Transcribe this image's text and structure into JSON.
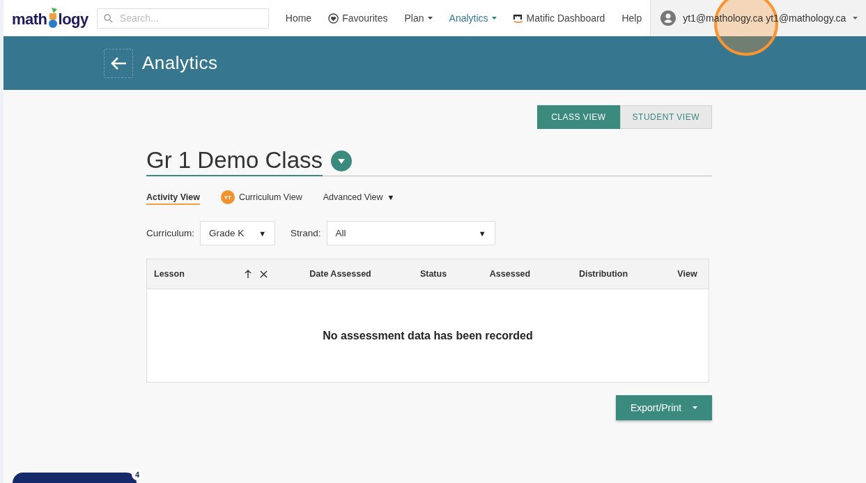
{
  "navbar": {
    "logo": {
      "before": "math",
      "after": "logy"
    },
    "search": {
      "placeholder": "Search..."
    },
    "items": [
      {
        "kind": "link",
        "label": "Home",
        "selected": false
      },
      {
        "kind": "favourites",
        "label": "Favourites",
        "selected": false
      },
      {
        "kind": "menu",
        "label": "Plan",
        "selected": false
      },
      {
        "kind": "menu",
        "label": "Analytics",
        "selected": true
      },
      {
        "kind": "brand",
        "label": "Matific Dashboard",
        "selected": false
      },
      {
        "kind": "link",
        "label": "Help",
        "selected": false
      }
    ],
    "user": {
      "email": "yt1@mathology.ca yt1@mathology.ca"
    }
  },
  "header": {
    "title": "Analytics"
  },
  "view_toggle": [
    {
      "label": "CLASS VIEW",
      "selected": true
    },
    {
      "label": "STUDENT VIEW",
      "selected": false
    }
  ],
  "class_title": "Gr 1 Demo Class",
  "view_tabs": [
    {
      "kind": "plain",
      "label": "Activity View",
      "selected": true
    },
    {
      "kind": "avatar",
      "avatar": "YT",
      "label": "Curriculum View",
      "selected": false
    },
    {
      "kind": "dropdown",
      "label": "Advanced View",
      "caret": "▼",
      "selected": false
    }
  ],
  "filters": [
    {
      "label": "Curriculum:",
      "value": "Grade K",
      "caret": "▼"
    },
    {
      "label": "Strand:",
      "value": "All",
      "caret": "▼"
    }
  ],
  "table": {
    "columns": [
      "Lesson",
      "Date Assessed",
      "Status",
      "Assessed",
      "Distribution",
      "View"
    ],
    "empty_message": "No assessment data has been recorded"
  },
  "export": {
    "label": "Export/Print"
  },
  "floating_button": {
    "badge": "4"
  }
}
